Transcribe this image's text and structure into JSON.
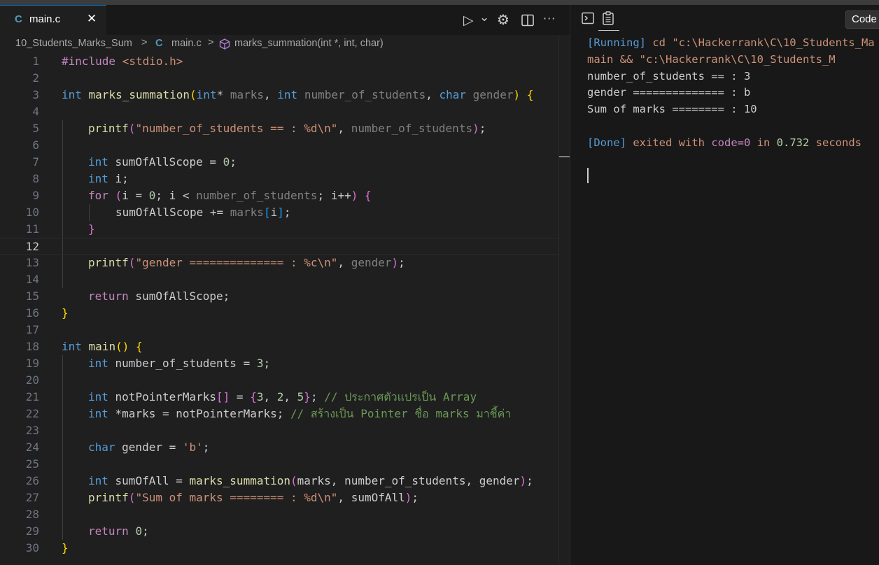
{
  "tab": {
    "lang_icon": "C",
    "title": "main.c",
    "close": "✕"
  },
  "actions": {
    "run_icon": "▷",
    "dropdown_icon": "⌄",
    "settings_icon": "⚙",
    "split_icon": "◫",
    "more_icon": "···"
  },
  "breadcrumb": {
    "folder": "10_Students_Marks_Sum",
    "sep": ">",
    "file_icon": "C",
    "file": "main.c",
    "symbol_icon": "cube-icon",
    "symbol": "marks_summation(int *, int, char)"
  },
  "line_numbers": [
    "1",
    "2",
    "3",
    "4",
    "5",
    "6",
    "7",
    "8",
    "9",
    "10",
    "11",
    "12",
    "13",
    "14",
    "15",
    "16",
    "17",
    "18",
    "19",
    "20",
    "21",
    "22",
    "23",
    "24",
    "25",
    "26",
    "27",
    "28",
    "29",
    "30"
  ],
  "code": {
    "l1": {
      "a": "#include ",
      "b": "<stdio.h>"
    },
    "l3": {
      "t1": "int",
      "fn": " marks_summation",
      "p1": "(",
      "t2": "int",
      "s1": "* ",
      "p_marks": "marks",
      "s2": ", ",
      "t3": "int",
      "s3": " ",
      "p_n": "number_of_students",
      "s4": ", ",
      "t4": "char",
      "s5": " ",
      "p_g": "gender",
      "p2": ")",
      "s6": " ",
      "br": "{"
    },
    "l5": {
      "fn": "printf",
      "p1": "(",
      "str": "\"number_of_students == : %d\\n\"",
      "s1": ", ",
      "arg": "number_of_students",
      "p2": ")",
      "s2": ";"
    },
    "l7": {
      "t": "int",
      "rest": " sumOfAllScope = ",
      "num": "0",
      "end": ";"
    },
    "l8": {
      "t": "int",
      "rest": " i;"
    },
    "l9": {
      "kw": "for",
      "s0": " ",
      "p1": "(",
      "a": "i = ",
      "num": "0",
      "b": "; i < ",
      "arg": "number_of_students",
      "c": "; i++",
      "p2": ")",
      "s1": " ",
      "br": "{"
    },
    "l10": {
      "a": "sumOfAllScope += ",
      "arg": "marks",
      "bo": "[",
      "i": "i",
      "bc": "]",
      "end": ";"
    },
    "l11": {
      "br": "}"
    },
    "l13": {
      "fn": "printf",
      "p1": "(",
      "str": "\"gender ============== : %c\\n\"",
      "s1": ", ",
      "arg": "gender",
      "p2": ")",
      "s2": ";"
    },
    "l15": {
      "kw": "return",
      "rest": " sumOfAllScope;"
    },
    "l16": {
      "br": "}"
    },
    "l18": {
      "t": "int",
      "fn": " main",
      "p": "()",
      "s": " ",
      "br": "{"
    },
    "l19": {
      "t": "int",
      "rest": " number_of_students = ",
      "num": "3",
      "end": ";"
    },
    "l21": {
      "t": "int",
      "rest": " notPointerMarks",
      "bo": "[]",
      "eq": " = ",
      "co": "{",
      "n1": "3",
      "c1": ", ",
      "n2": "2",
      "c2": ", ",
      "n3": "5",
      "cc": "}",
      "end": "; ",
      "cmt": "// ประกาศตัวแปรเป็น Array"
    },
    "l22": {
      "t": "int",
      "rest": " *marks = notPointerMarks; ",
      "cmt": "// สร้างเป็น Pointer ชื่อ marks มาชี้ค่า"
    },
    "l24": {
      "t": "char",
      "rest": " gender = ",
      "str": "'b'",
      "end": ";"
    },
    "l26": {
      "t": "int",
      "a": " sumOfAll = ",
      "fn": "marks_summation",
      "p1": "(",
      "args": "marks, number_of_students, gender",
      "p2": ")",
      "end": ";"
    },
    "l27": {
      "fn": "printf",
      "p1": "(",
      "str": "\"Sum of marks ======== : %d\\n\"",
      "s1": ", ",
      "arg": "sumOfAll",
      "p2": ")",
      "end": ";"
    },
    "l29": {
      "kw": "return",
      "s": " ",
      "num": "0",
      "end": ";"
    },
    "l30": {
      "br": "}"
    }
  },
  "output_panel": {
    "terminal_icon": "terminal-icon",
    "clipboard_icon": "clipboard-icon",
    "code_button": "Code",
    "line1_tag": "[Running]",
    "line1_text": " cd \"c:\\Hackerrank\\C\\10_Students_Ma",
    "line2_text": "main && \"c:\\Hackerrank\\C\\10_Students_M",
    "line3": "number_of_students == : 3",
    "line4": "gender ============== : b",
    "line5": "Sum of marks ======== : 10",
    "done_tag": "[Done]",
    "done_a": " exited with ",
    "done_code": "code=0",
    "done_in": " in ",
    "done_time": "0.732",
    "done_secs": " seconds"
  },
  "colors": {
    "background": "#1f1f1f",
    "keyword": "#569cd6",
    "function": "#dcdcaa",
    "string": "#ce9178",
    "number": "#b5cea8",
    "comment": "#6a9955",
    "accent": "#0078d4"
  }
}
